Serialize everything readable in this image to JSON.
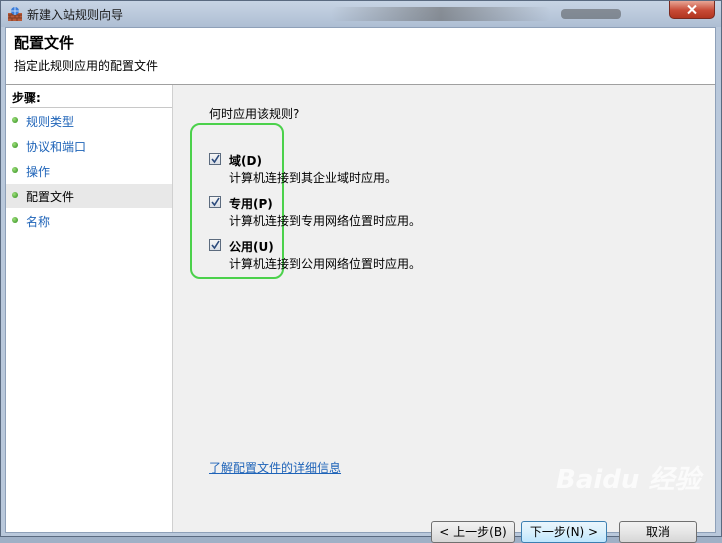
{
  "window": {
    "title": "新建入站规则向导"
  },
  "header": {
    "title": "配置文件",
    "subtitle": "指定此规则应用的配置文件"
  },
  "steps": {
    "heading": "步骤:",
    "items": [
      {
        "label": "规则类型"
      },
      {
        "label": "协议和端口"
      },
      {
        "label": "操作"
      },
      {
        "label": "配置文件",
        "active": true
      },
      {
        "label": "名称"
      }
    ]
  },
  "content": {
    "question": "何时应用该规则?",
    "options": [
      {
        "label": "域(D)",
        "description": "计算机连接到其企业域时应用。",
        "checked": true
      },
      {
        "label": "专用(P)",
        "description": "计算机连接到专用网络位置时应用。",
        "checked": true
      },
      {
        "label": "公用(U)",
        "description": "计算机连接到公用网络位置时应用。",
        "checked": true
      }
    ],
    "learn_more": "了解配置文件的详细信息"
  },
  "buttons": {
    "back": "< 上一步(B)",
    "next": "下一步(N) >",
    "cancel": "取消"
  },
  "watermark": "Baidu 经验",
  "colors": {
    "link": "#1e63b8",
    "highlight": "#4bd14b",
    "close": "#c74a36"
  }
}
